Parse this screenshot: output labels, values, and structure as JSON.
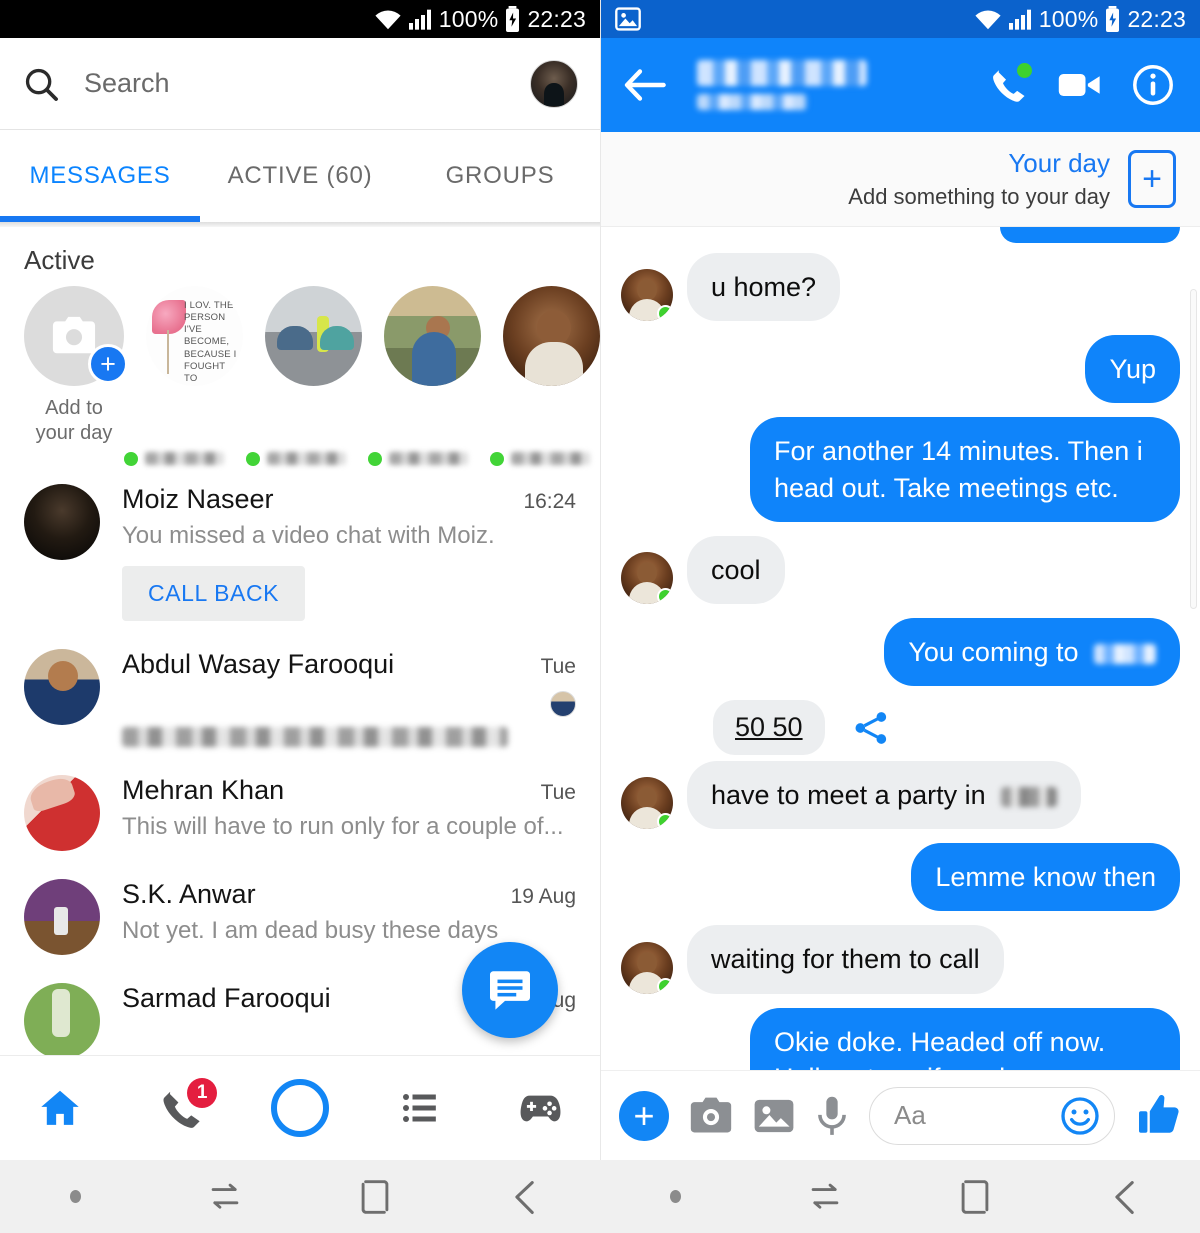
{
  "status_bar": {
    "battery_percent": "100%",
    "time": "22:23",
    "wifi_icon": "wifi-icon",
    "signal_icon": "cellular-signal-icon",
    "battery_icon": "battery-charging-icon",
    "image_notification_icon": "image-notification-icon"
  },
  "left_pane": {
    "search": {
      "placeholder": "Search",
      "icon": "search-icon"
    },
    "profile_avatar": "profile-avatar",
    "tabs": [
      {
        "label": "MESSAGES",
        "active": true
      },
      {
        "label": "ACTIVE (60)",
        "active": false
      },
      {
        "label": "GROUPS",
        "active": false
      }
    ],
    "active_section": {
      "title": "Active",
      "add_story": {
        "label": "Add to your day",
        "icon": "camera-icon",
        "badge": "+"
      },
      "stories": [
        {
          "name_redacted": true,
          "online": true,
          "art": "flower-quote"
        },
        {
          "name_redacted": true,
          "online": true,
          "art": "vintage-cars"
        },
        {
          "name_redacted": true,
          "online": true,
          "art": "hiking-portrait"
        },
        {
          "name_redacted": true,
          "online": true,
          "art": "man-portrait"
        }
      ],
      "story_quote_text": "I LOV. THE PERSON I'VE BECOME, BECAUSE I FOUGHT TO BECOME HER"
    },
    "conversations": [
      {
        "name": "Moiz Naseer",
        "snippet": "You missed a video chat with Moiz.",
        "time": "16:24",
        "action_button": "CALL BACK",
        "snippet_redacted": false
      },
      {
        "name": "Abdul Wasay Farooqui",
        "snippet": "",
        "time": "Tue",
        "snippet_redacted": true,
        "seen_avatar": true
      },
      {
        "name": "Mehran Khan",
        "snippet": "This will have to run only for a couple of...",
        "time": "Tue",
        "snippet_redacted": false
      },
      {
        "name": "S.K. Anwar",
        "snippet": "Not yet. I am dead busy these days",
        "time": "19 Aug",
        "snippet_redacted": false
      },
      {
        "name": "Sarmad Farooqui",
        "snippet": "",
        "time": "18 Aug",
        "snippet_redacted": false
      }
    ],
    "fab": {
      "icon": "new-message-icon"
    },
    "bottom_nav": [
      {
        "name": "home",
        "icon": "home-icon",
        "active": true,
        "badge": ""
      },
      {
        "name": "calls",
        "icon": "phone-icon",
        "active": false,
        "badge": "1"
      },
      {
        "name": "camera",
        "icon": "camera-ring-icon",
        "active": false,
        "badge": ""
      },
      {
        "name": "people",
        "icon": "list-icon",
        "active": false,
        "badge": ""
      },
      {
        "name": "games",
        "icon": "gamepad-icon",
        "active": false,
        "badge": ""
      }
    ]
  },
  "right_pane": {
    "header": {
      "back_icon": "back-arrow-icon",
      "contact_name_redacted": true,
      "contact_status_redacted": true,
      "audio_call_icon": "phone-icon",
      "audio_call_online_dot": true,
      "video_call_icon": "video-camera-icon",
      "info_icon": "info-icon"
    },
    "your_day": {
      "title": "Your day",
      "subtitle": "Add something to your day",
      "add_icon": "plus-box-icon"
    },
    "messages": [
      {
        "id": "m0",
        "side": "out",
        "text": "",
        "partial_top": true
      },
      {
        "id": "m1",
        "side": "in",
        "text": "u home?",
        "avatar": true
      },
      {
        "id": "m2",
        "side": "out",
        "text": "Yup"
      },
      {
        "id": "m3",
        "side": "out",
        "text": "For another 14 minutes. Then i head out. Take meetings etc."
      },
      {
        "id": "m4",
        "side": "in",
        "text": "cool",
        "avatar": true
      },
      {
        "id": "m5",
        "side": "out",
        "text": "You coming to",
        "redacted_tail": true
      },
      {
        "id": "m6",
        "side": "in",
        "text": "50 50",
        "link": true,
        "share_icon": "share-icon"
      },
      {
        "id": "m7",
        "side": "in",
        "text": "have to meet a party in",
        "redacted_tail": true,
        "avatar": true
      },
      {
        "id": "m8",
        "side": "out",
        "text": "Lemme know then"
      },
      {
        "id": "m9",
        "side": "in",
        "text": "waiting for them to call",
        "avatar": true
      },
      {
        "id": "m10",
        "side": "out",
        "text": "Okie doke. Headed off now. Holler at me if you here"
      },
      {
        "id": "m11",
        "side": "in",
        "text": "",
        "sticker": "thumbs-up-icon",
        "avatar": true,
        "seen_avatar": true
      }
    ],
    "composer": {
      "plus_icon": "plus-circle-icon",
      "camera_icon": "camera-icon",
      "gallery_icon": "gallery-icon",
      "mic_icon": "microphone-icon",
      "input_placeholder": "Aa",
      "emoji_icon": "emoji-smiley-icon",
      "like_icon": "thumbs-up-icon"
    }
  },
  "android_nav": [
    {
      "name": "dot",
      "icon": "dot-icon"
    },
    {
      "name": "recents",
      "icon": "recents-icon"
    },
    {
      "name": "home",
      "icon": "home-square-icon"
    },
    {
      "name": "back",
      "icon": "back-chevron-icon"
    }
  ],
  "colors": {
    "messenger_blue": "#0f84fa",
    "status_blue": "#0b62cc",
    "accent_blue": "#1878f2",
    "bubble_grey": "#eceef0",
    "online_green": "#3ed12f",
    "badge_red": "#e41e3f"
  }
}
